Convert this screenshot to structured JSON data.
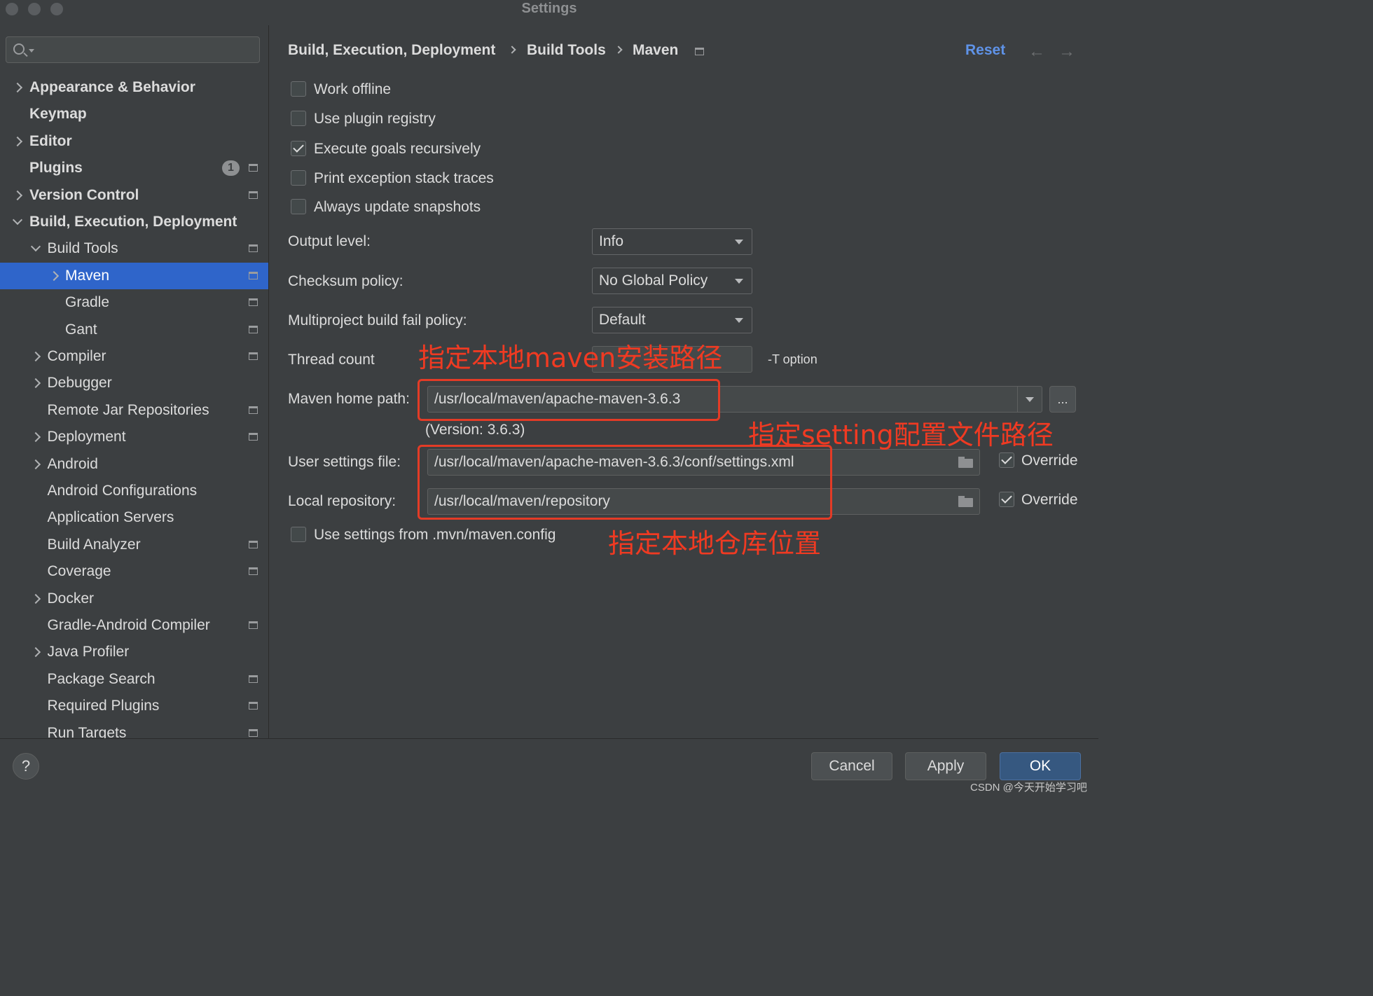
{
  "window": {
    "title": "Settings"
  },
  "sidebar": {
    "search": {
      "placeholder": ""
    },
    "items": [
      {
        "label": "Appearance & Behavior",
        "bold": true,
        "expand": "right",
        "level": 0,
        "badge": "",
        "proj": false,
        "selected": false
      },
      {
        "label": "Keymap",
        "bold": true,
        "expand": "",
        "level": 0,
        "badge": "",
        "proj": false,
        "selected": false
      },
      {
        "label": "Editor",
        "bold": true,
        "expand": "right",
        "level": 0,
        "badge": "",
        "proj": false,
        "selected": false
      },
      {
        "label": "Plugins",
        "bold": true,
        "expand": "",
        "level": 0,
        "badge": "1",
        "proj": true,
        "selected": false
      },
      {
        "label": "Version Control",
        "bold": true,
        "expand": "right",
        "level": 0,
        "badge": "",
        "proj": true,
        "selected": false
      },
      {
        "label": "Build, Execution, Deployment",
        "bold": true,
        "expand": "down",
        "level": 0,
        "badge": "",
        "proj": false,
        "selected": false
      },
      {
        "label": "Build Tools",
        "bold": false,
        "expand": "down",
        "level": 1,
        "badge": "",
        "proj": true,
        "selected": false
      },
      {
        "label": "Maven",
        "bold": false,
        "expand": "right",
        "level": 2,
        "badge": "",
        "proj": true,
        "selected": true
      },
      {
        "label": "Gradle",
        "bold": false,
        "expand": "",
        "level": 2,
        "badge": "",
        "proj": true,
        "selected": false
      },
      {
        "label": "Gant",
        "bold": false,
        "expand": "",
        "level": 2,
        "badge": "",
        "proj": true,
        "selected": false
      },
      {
        "label": "Compiler",
        "bold": false,
        "expand": "right",
        "level": 1,
        "badge": "",
        "proj": true,
        "selected": false
      },
      {
        "label": "Debugger",
        "bold": false,
        "expand": "right",
        "level": 1,
        "badge": "",
        "proj": false,
        "selected": false
      },
      {
        "label": "Remote Jar Repositories",
        "bold": false,
        "expand": "",
        "level": 1,
        "badge": "",
        "proj": true,
        "selected": false
      },
      {
        "label": "Deployment",
        "bold": false,
        "expand": "right",
        "level": 1,
        "badge": "",
        "proj": true,
        "selected": false
      },
      {
        "label": "Android",
        "bold": false,
        "expand": "right",
        "level": 1,
        "badge": "",
        "proj": false,
        "selected": false
      },
      {
        "label": "Android Configurations",
        "bold": false,
        "expand": "",
        "level": 1,
        "badge": "",
        "proj": false,
        "selected": false
      },
      {
        "label": "Application Servers",
        "bold": false,
        "expand": "",
        "level": 1,
        "badge": "",
        "proj": false,
        "selected": false
      },
      {
        "label": "Build Analyzer",
        "bold": false,
        "expand": "",
        "level": 1,
        "badge": "",
        "proj": true,
        "selected": false
      },
      {
        "label": "Coverage",
        "bold": false,
        "expand": "",
        "level": 1,
        "badge": "",
        "proj": true,
        "selected": false
      },
      {
        "label": "Docker",
        "bold": false,
        "expand": "right",
        "level": 1,
        "badge": "",
        "proj": false,
        "selected": false
      },
      {
        "label": "Gradle-Android Compiler",
        "bold": false,
        "expand": "",
        "level": 1,
        "badge": "",
        "proj": true,
        "selected": false
      },
      {
        "label": "Java Profiler",
        "bold": false,
        "expand": "right",
        "level": 1,
        "badge": "",
        "proj": false,
        "selected": false
      },
      {
        "label": "Package Search",
        "bold": false,
        "expand": "",
        "level": 1,
        "badge": "",
        "proj": true,
        "selected": false
      },
      {
        "label": "Required Plugins",
        "bold": false,
        "expand": "",
        "level": 1,
        "badge": "",
        "proj": true,
        "selected": false
      },
      {
        "label": "Run Targets",
        "bold": false,
        "expand": "",
        "level": 1,
        "badge": "",
        "proj": true,
        "selected": false
      }
    ]
  },
  "header": {
    "breadcrumb": [
      "Build, Execution, Deployment",
      "Build Tools",
      "Maven"
    ],
    "reset_label": "Reset",
    "back_icon": "arrow-left-icon",
    "forward_icon": "arrow-right-icon"
  },
  "maven": {
    "checkboxes": [
      {
        "label": "Work offline",
        "checked": false
      },
      {
        "label": "Use plugin registry",
        "checked": false
      },
      {
        "label": "Execute goals recursively",
        "checked": true
      },
      {
        "label": "Print exception stack traces",
        "checked": false
      },
      {
        "label": "Always update snapshots",
        "checked": false
      }
    ],
    "output_level": {
      "label": "Output level:",
      "value": "Info"
    },
    "checksum_policy": {
      "label": "Checksum policy:",
      "value": "No Global Policy"
    },
    "multiproject_policy": {
      "label": "Multiproject build fail policy:",
      "value": "Default"
    },
    "thread_count": {
      "label": "Thread count",
      "value": "",
      "suffix": "-T option"
    },
    "home_path": {
      "label": "Maven home path:",
      "value": "/usr/local/maven/apache-maven-3.6.3",
      "browse_label": "...",
      "version": "(Version: 3.6.3)"
    },
    "user_settings": {
      "label": "User settings file:",
      "value": "/usr/local/maven/apache-maven-3.6.3/conf/settings.xml",
      "override_label": "Override",
      "override": true
    },
    "local_repo": {
      "label": "Local repository:",
      "value": "/usr/local/maven/repository",
      "override_label": "Override",
      "override": true
    },
    "mvn_config": {
      "label": "Use settings from .mvn/maven.config",
      "checked": false
    }
  },
  "annotations": {
    "home": "指定本地maven安装路径",
    "settings": "指定setting配置文件路径",
    "repo": "指定本地仓库位置",
    "color": "#e43b26"
  },
  "footer": {
    "help_label": "?",
    "cancel_label": "Cancel",
    "apply_label": "Apply",
    "ok_label": "OK",
    "watermark": "CSDN @今天开始学习吧"
  }
}
